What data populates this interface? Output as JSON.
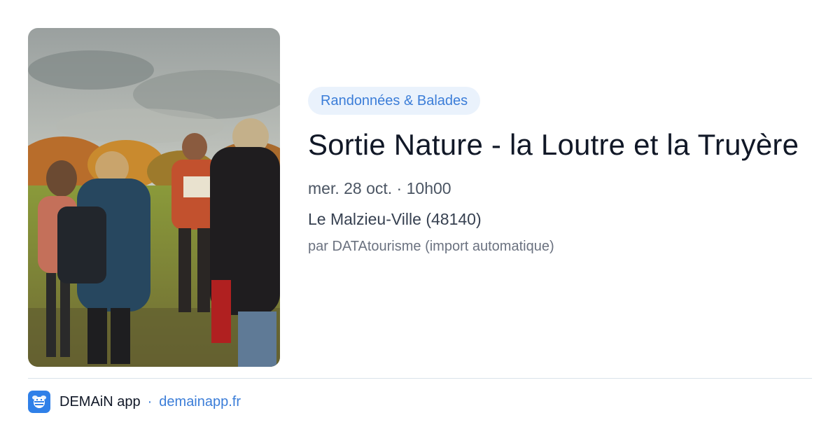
{
  "category_badge": "Randonnées & Balades",
  "event": {
    "title": "Sortie Nature - la Loutre et la Truyère",
    "datetime": "mer. 28 oct. · 10h00",
    "location": "Le Malzieu-Ville (48140)",
    "source": "par DATAtourisme (import automatique)"
  },
  "footer": {
    "app_name": "DEMAiN app",
    "separator": "·",
    "url": "demainapp.fr"
  },
  "colors": {
    "accent": "#3b7dd8",
    "badge_bg": "#eaf2fc",
    "title": "#111827",
    "app_icon_bg": "#2f80e8"
  },
  "icons": {
    "app": "bee-logo-icon"
  }
}
